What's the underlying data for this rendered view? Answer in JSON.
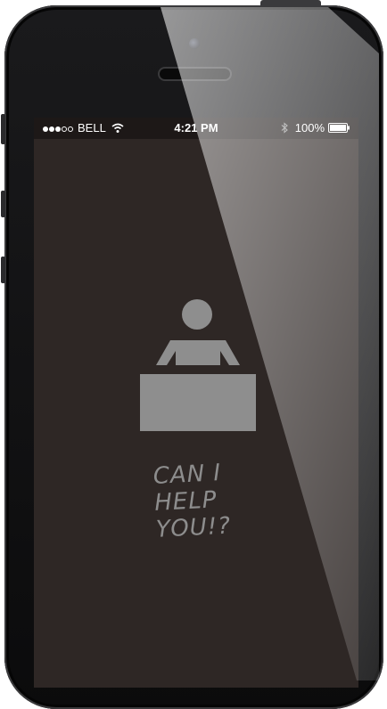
{
  "status_bar": {
    "signal_filled": 3,
    "signal_total": 5,
    "carrier": "BELL",
    "time": "4:21 PM",
    "battery": "100%"
  },
  "main": {
    "icon": "help-desk-person-icon",
    "slogan": {
      "line1": "CAN I",
      "line2": "HELP",
      "line3": "YOU!?"
    }
  },
  "colors": {
    "screen_bg": "#2e2725",
    "icon": "#8e8e8e",
    "phone_body": "#111112"
  }
}
